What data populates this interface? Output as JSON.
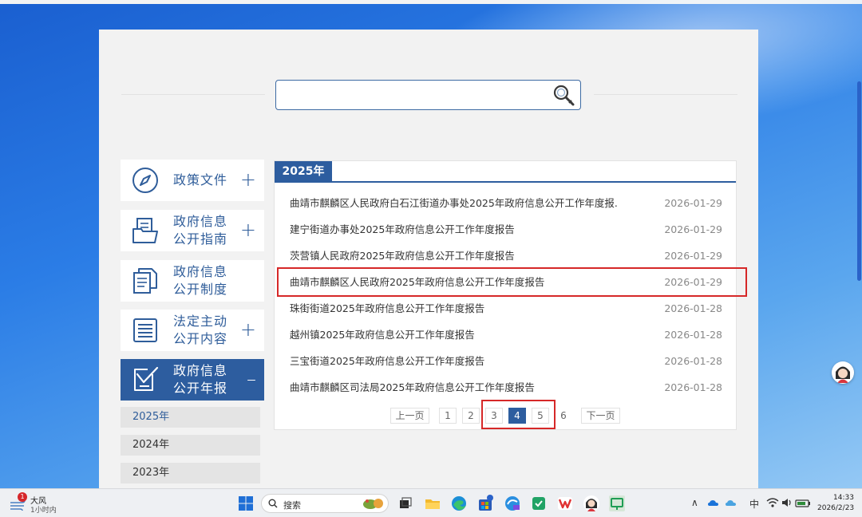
{
  "colors": {
    "accent": "#2d5d9f",
    "highlight": "#d62828",
    "panel_bg": "#ffffff",
    "page_bg": "#f2f2f2"
  },
  "search": {
    "placeholder": "",
    "value": "",
    "icon": "search-key-icon"
  },
  "sidebar": {
    "items": [
      {
        "label": "政策文件",
        "icon": "compass-icon",
        "toggle": "+"
      },
      {
        "label": "政府信息公开指南",
        "icon": "folder-document-icon",
        "toggle": "+"
      },
      {
        "label": "政府信息公开制度",
        "icon": "documents-icon",
        "toggle": ""
      },
      {
        "label": "法定主动公开内容",
        "icon": "list-document-icon",
        "toggle": "+"
      },
      {
        "label": "政府信息公开年报",
        "icon": "edit-box-icon",
        "toggle": "–"
      }
    ],
    "years": [
      "2025年",
      "2024年",
      "2023年"
    ]
  },
  "panel": {
    "tab": "2025年",
    "rows": [
      {
        "title": "曲靖市麒麟区人民政府白石江街道办事处2025年政府信息公开工作年度报...",
        "date": "2026-01-29"
      },
      {
        "title": "建宁街道办事处2025年政府信息公开工作年度报告",
        "date": "2026-01-29"
      },
      {
        "title": "茨营镇人民政府2025年政府信息公开工作年度报告",
        "date": "2026-01-29"
      },
      {
        "title": "曲靖市麒麟区人民政府2025年政府信息公开工作年度报告",
        "date": "2026-01-29"
      },
      {
        "title": "珠街街道2025年政府信息公开工作年度报告",
        "date": "2026-01-28"
      },
      {
        "title": "越州镇2025年政府信息公开工作年度报告",
        "date": "2026-01-28"
      },
      {
        "title": "三宝街道2025年政府信息公开工作年度报告",
        "date": "2026-01-28"
      },
      {
        "title": "曲靖市麒麟区司法局2025年政府信息公开工作年度报告",
        "date": "2026-01-28"
      }
    ],
    "highlighted_row": 4
  },
  "pagination": {
    "prev": "上一页",
    "pages": [
      "1",
      "2",
      "3",
      "4",
      "5",
      "6"
    ],
    "current": "4",
    "next": "下一页"
  },
  "taskbar": {
    "weather_title": "大风",
    "weather_sub": "1小时内",
    "weather_badge": "1",
    "search_label": "搜索",
    "ime": "中",
    "time": "14:33",
    "date": "2026/2/23",
    "store_badge": "1"
  }
}
